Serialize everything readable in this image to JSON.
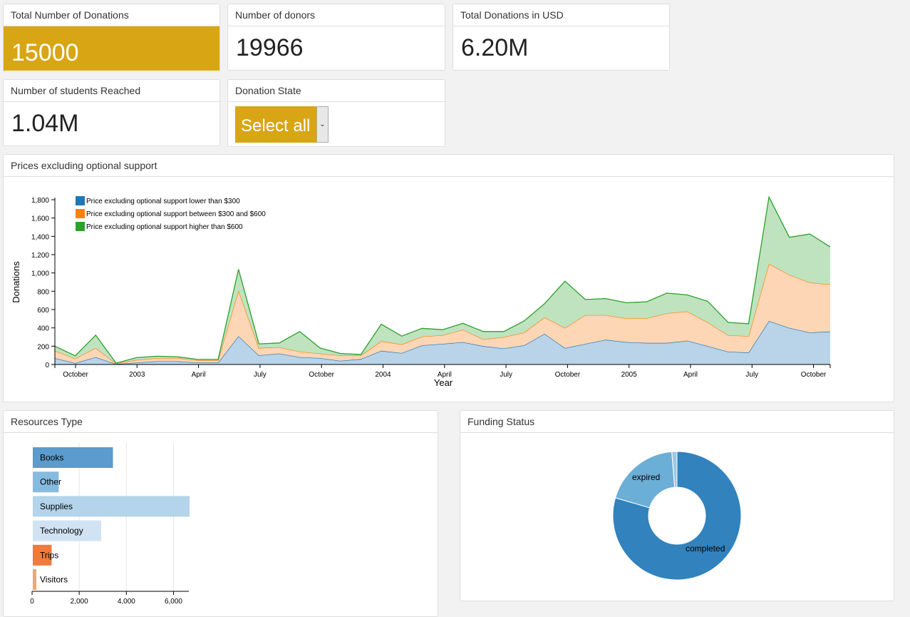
{
  "kpis": {
    "total_donations": {
      "label": "Total Number of Donations",
      "value": "15000"
    },
    "donors": {
      "label": "Number of donors",
      "value": "19966"
    },
    "usd": {
      "label": "Total Donations in USD",
      "value": "6.20M"
    },
    "students": {
      "label": "Number of students Reached",
      "value": "1.04M"
    }
  },
  "donation_state": {
    "label": "Donation State",
    "selected": "Select all"
  },
  "colors": {
    "gold": "#d8a614",
    "blue": "#1f77b4",
    "blue_fill": "#b9d3e8",
    "orange": "#ff7f0e",
    "orange_fill": "#fdd6b6",
    "green": "#2ca02c",
    "green_fill": "#bfe3bf"
  },
  "chart_data": [
    {
      "type": "area",
      "panel_title": "Prices excluding optional support",
      "stacked": true,
      "xlabel": "Year",
      "ylabel": "Donations",
      "ylim": [
        0,
        1800
      ],
      "yticks": [
        "0",
        "200",
        "400",
        "600",
        "800",
        "1,000",
        "1,200",
        "1,400",
        "1,600",
        "1,800"
      ],
      "xticks": [
        "October",
        "2003",
        "April",
        "July",
        "October",
        "2004",
        "April",
        "July",
        "October",
        "2005",
        "April",
        "July",
        "October"
      ],
      "series": [
        {
          "name": "Price excluding optional support lower than $300",
          "values": [
            70,
            15,
            80,
            5,
            20,
            35,
            35,
            20,
            20,
            310,
            100,
            120,
            80,
            70,
            40,
            60,
            150,
            125,
            210,
            225,
            245,
            200,
            175,
            210,
            335,
            180,
            225,
            270,
            245,
            235,
            235,
            260,
            200,
            140,
            130,
            475,
            400,
            350,
            360
          ]
        },
        {
          "name": "Price excluding optional support between $300 and $600",
          "values": [
            80,
            50,
            100,
            5,
            30,
            35,
            35,
            25,
            25,
            500,
            80,
            70,
            60,
            50,
            60,
            40,
            105,
            95,
            95,
            95,
            135,
            75,
            125,
            140,
            180,
            220,
            315,
            270,
            260,
            270,
            325,
            320,
            260,
            180,
            180,
            625,
            580,
            545,
            515
          ]
        },
        {
          "name": "Price excluding optional support higher than $600",
          "values": [
            50,
            30,
            140,
            5,
            25,
            20,
            15,
            10,
            10,
            230,
            45,
            45,
            220,
            60,
            20,
            10,
            185,
            90,
            90,
            60,
            70,
            85,
            60,
            125,
            150,
            510,
            170,
            180,
            170,
            180,
            220,
            180,
            230,
            140,
            135,
            730,
            410,
            530,
            410
          ]
        }
      ]
    },
    {
      "type": "bar",
      "panel_title": "Resources Type",
      "orientation": "horizontal",
      "categories": [
        "Books",
        "Other",
        "Supplies",
        "Technology",
        "Trips",
        "Visitors"
      ],
      "values": [
        3400,
        1100,
        6650,
        2900,
        800,
        150
      ],
      "colors": [
        "#5b9bcd",
        "#86bbe0",
        "#b3d4ea",
        "#d1e3f3",
        "#ef7b3c",
        "#f2a76c"
      ],
      "xticks": [
        "0",
        "2,000",
        "4,000",
        "6,000"
      ],
      "xlim": [
        0,
        6650
      ]
    },
    {
      "type": "pie",
      "panel_title": "Funding Status",
      "donut": true,
      "labels": [
        "completed",
        "expired"
      ],
      "values": [
        79.5,
        19.2,
        1.3
      ],
      "colors": [
        "#3182bd",
        "#6baed6",
        "#9ecae1"
      ]
    }
  ]
}
